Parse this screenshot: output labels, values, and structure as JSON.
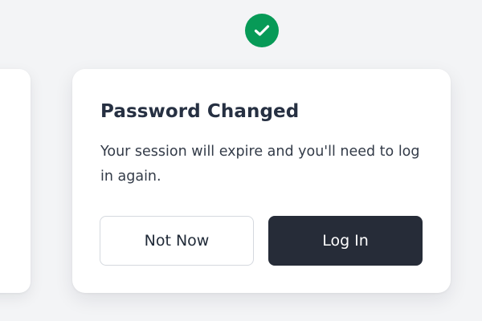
{
  "status": {
    "icon": "check-circle-icon",
    "color": "#079a57"
  },
  "dialog": {
    "title": "Password Changed",
    "message": "Your session will expire and you'll need to log in again.",
    "secondary_button": "Not Now",
    "primary_button": "Log In"
  },
  "colors": {
    "background": "#f3f4f6",
    "card": "#ffffff",
    "primary_button": "#262c38",
    "title_text": "#263042"
  }
}
